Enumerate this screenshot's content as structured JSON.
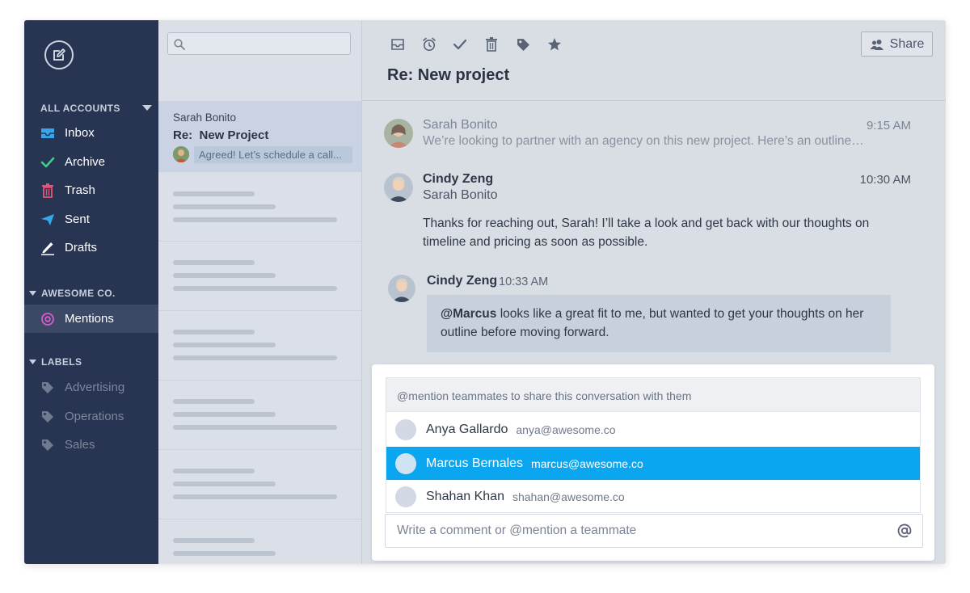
{
  "sidebar": {
    "all_accounts": "ALL ACCOUNTS",
    "items": [
      {
        "label": "Inbox"
      },
      {
        "label": "Archive"
      },
      {
        "label": "Trash"
      },
      {
        "label": "Sent"
      },
      {
        "label": "Drafts"
      }
    ],
    "org_section": "AWESOME CO.",
    "org_items": [
      {
        "label": "Mentions"
      }
    ],
    "labels_section": "LABELS",
    "labels": [
      {
        "label": "Advertising"
      },
      {
        "label": "Operations"
      },
      {
        "label": "Sales"
      }
    ],
    "colors": {
      "inbox": "#35a7e8",
      "archive": "#3fce8c",
      "trash": "#e8537a",
      "sent": "#35a7e8",
      "mentions": "#d75ec8"
    }
  },
  "thread_list": {
    "selected": {
      "from": "Sarah Bonito",
      "subject": "Re:  New Project",
      "preview": "Agreed! Let’s schedule a call..."
    }
  },
  "toolbar": {
    "icons": [
      "inbox-icon",
      "alarm-clock-icon",
      "checkmark-icon",
      "trash-icon",
      "tag-icon",
      "star-icon"
    ],
    "share_label": "Share"
  },
  "conversation": {
    "subject": "Re: New project",
    "messages": [
      {
        "from": "Sarah Bonito",
        "time": "9:15 AM",
        "preview": "We’re looking to partner with an agency on this new project. Here’s an outline…"
      },
      {
        "from": "Cindy Zeng",
        "to": "Sarah Bonito",
        "time": "10:30 AM",
        "body_line1": "Thanks for reaching out, Sarah! I’ll take a look and get back with our thoughts on",
        "body_line2": "timeline and pricing as soon as possible."
      }
    ],
    "comment": {
      "from": "Cindy Zeng",
      "time": "10:33 AM",
      "mention": "@Marcus",
      "body_line1": " looks like a great fit to me, but wanted to get your thoughts on her",
      "body_line2": "outline before moving forward."
    }
  },
  "mention_popup": {
    "header": "@mention teammates to share this conversation with them",
    "people": [
      {
        "name": "Anya Gallardo",
        "email": "anya@awesome.co"
      },
      {
        "name": "Marcus Bernales",
        "email": "marcus@awesome.co"
      },
      {
        "name": "Shahan Khan",
        "email": "shahan@awesome.co"
      }
    ],
    "highlight_color": "#0aa6ef"
  },
  "comment_input": {
    "placeholder": "Write a comment or @mention a teammate"
  }
}
